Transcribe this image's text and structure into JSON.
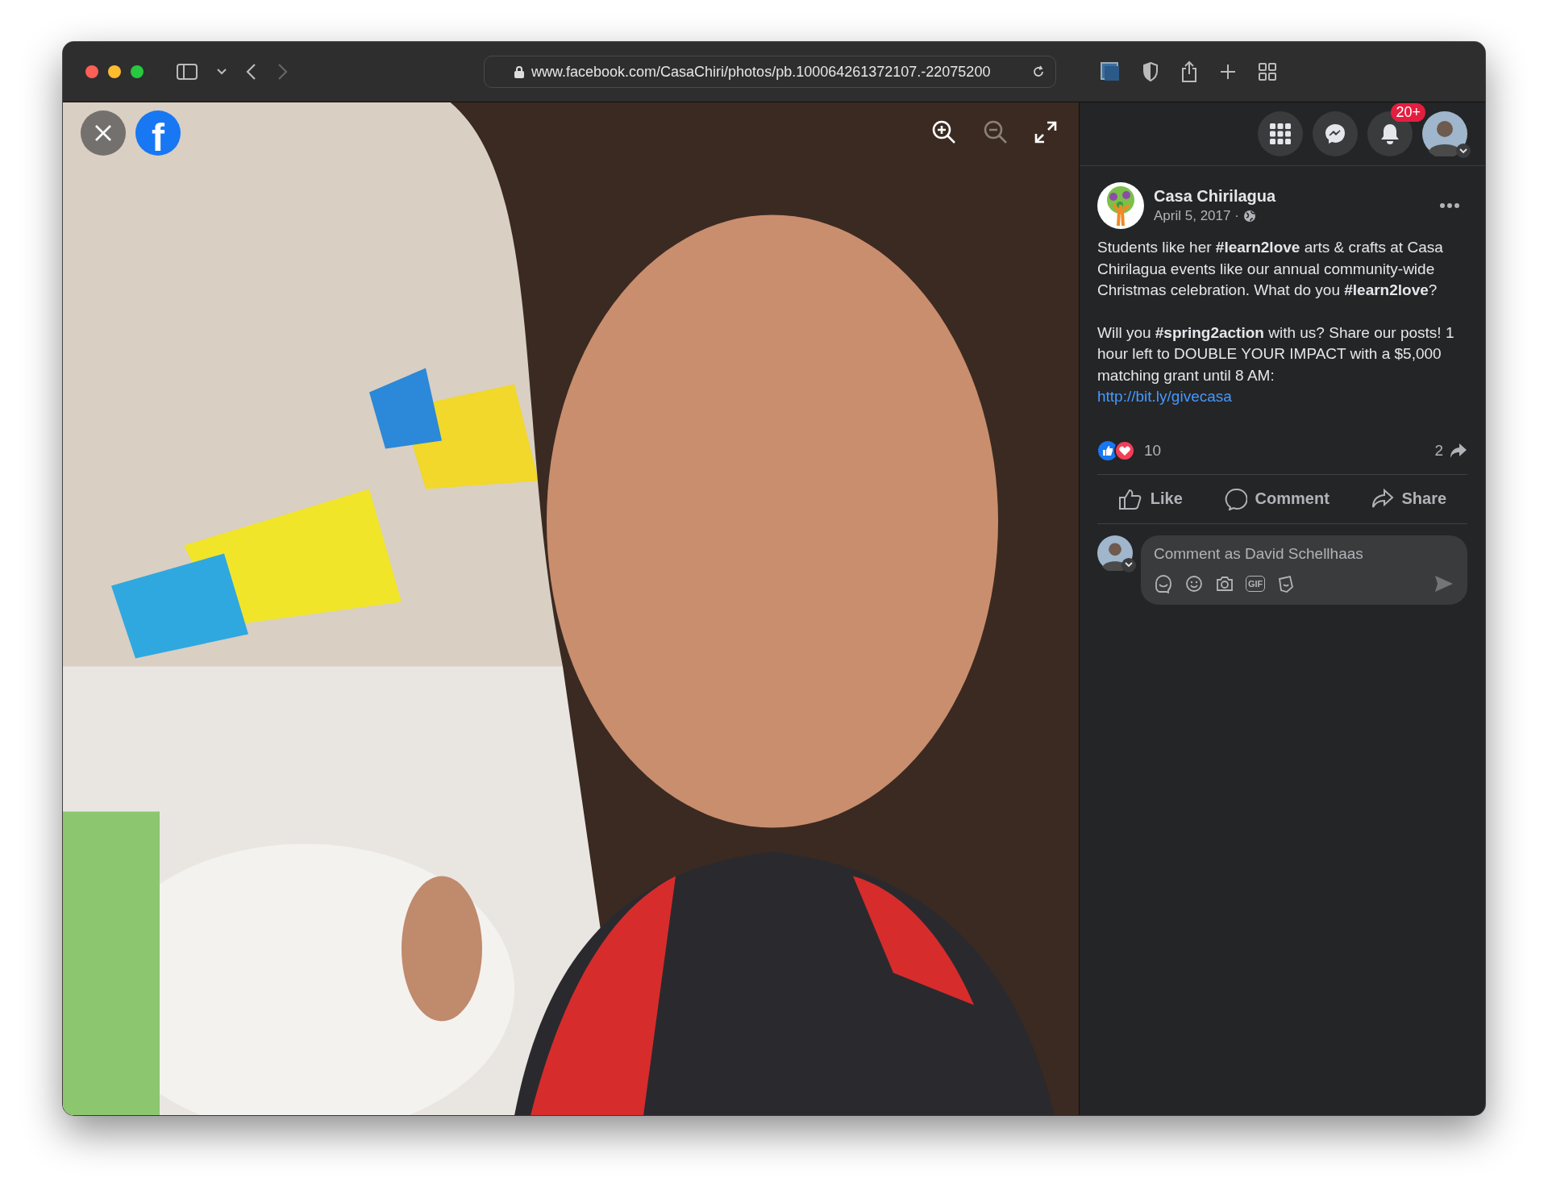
{
  "browser": {
    "url": "www.facebook.com/CasaChiri/photos/pb.100064261372107.-22075200"
  },
  "viewer": {
    "logo_letter": "f"
  },
  "header": {
    "notification_count": "20+"
  },
  "post": {
    "author": "Casa Chirilagua",
    "date": "April 5, 2017 ·",
    "paragraphs": [
      "Students like her **#learn2love** arts & crafts at Casa Chirilagua events like our annual community-wide Christmas celebration. What do you **#learn2love**?",
      "Will you **#spring2action** with us? Share our posts! 1 hour left to DOUBLE YOUR IMPACT with a $5,000 matching grant until 8 AM:"
    ],
    "link": "http://bit.ly/givecasa",
    "reaction_count": "10",
    "share_count": "2",
    "actions": [
      {
        "kind": "like",
        "label": "Like"
      },
      {
        "kind": "comment",
        "label": "Comment"
      },
      {
        "kind": "share",
        "label": "Share"
      }
    ]
  },
  "comment_box": {
    "placeholder": "Comment as David Schellhaas",
    "gif_label": "GIF"
  }
}
